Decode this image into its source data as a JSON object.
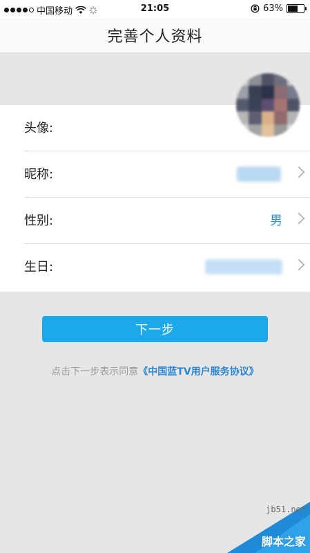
{
  "status_bar": {
    "carrier": "中国移动",
    "time": "21:05",
    "battery_percent": "63%",
    "battery_level": 0.63,
    "signal_icon": "signal-dots-icon",
    "wifi_icon": "wifi-icon",
    "loading_icon": "spinner-icon",
    "lock_icon": "orientation-lock-icon"
  },
  "nav": {
    "title": "完善个人资料"
  },
  "form": {
    "rows": [
      {
        "label": "头像:"
      },
      {
        "label": "昵称:"
      },
      {
        "label": "性别:",
        "value": "男"
      },
      {
        "label": "生日:"
      }
    ]
  },
  "actions": {
    "next_label": "下一步"
  },
  "agreement": {
    "text": "点击下一步表示同意",
    "link": "《中国蓝TV用户服务协议》"
  },
  "watermark": {
    "url": "jb51.net",
    "name": "脚本之家"
  },
  "colors": {
    "accent": "#1ea8ec",
    "link": "#2b84cf",
    "background": "#e6e6e6"
  }
}
